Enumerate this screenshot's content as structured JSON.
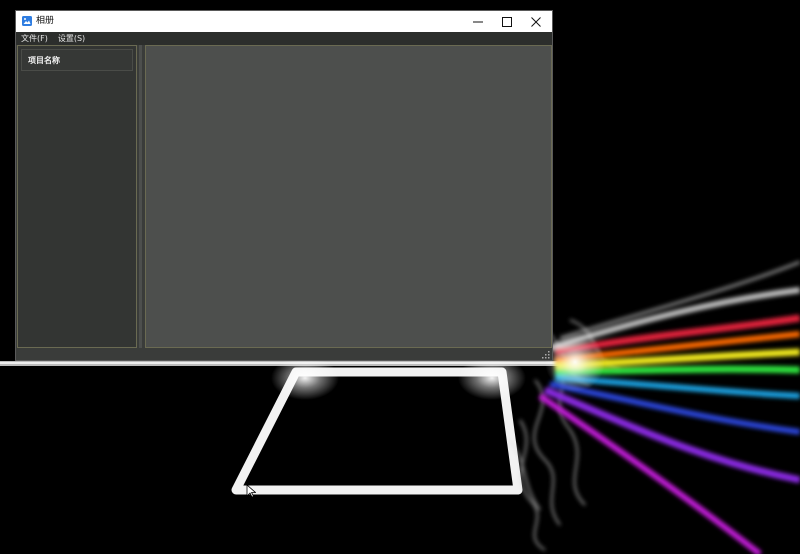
{
  "window": {
    "title": "相册",
    "menu": [
      "文件(F)",
      "设置(S)"
    ],
    "left_panel": {
      "header": "项目名称"
    }
  },
  "colors": {
    "window_bg": "#3a3c3a",
    "main_panel_bg": "#4d4f4d",
    "titlebar_bg": "#ffffff",
    "app_icon": "#2f7de1"
  },
  "icons": {
    "app": "photo-album-icon",
    "minimize": "minimize-icon",
    "maximize": "maximize-icon",
    "close": "close-icon",
    "resize": "resize-grip-icon",
    "cursor": "mouse-pointer-icon"
  }
}
